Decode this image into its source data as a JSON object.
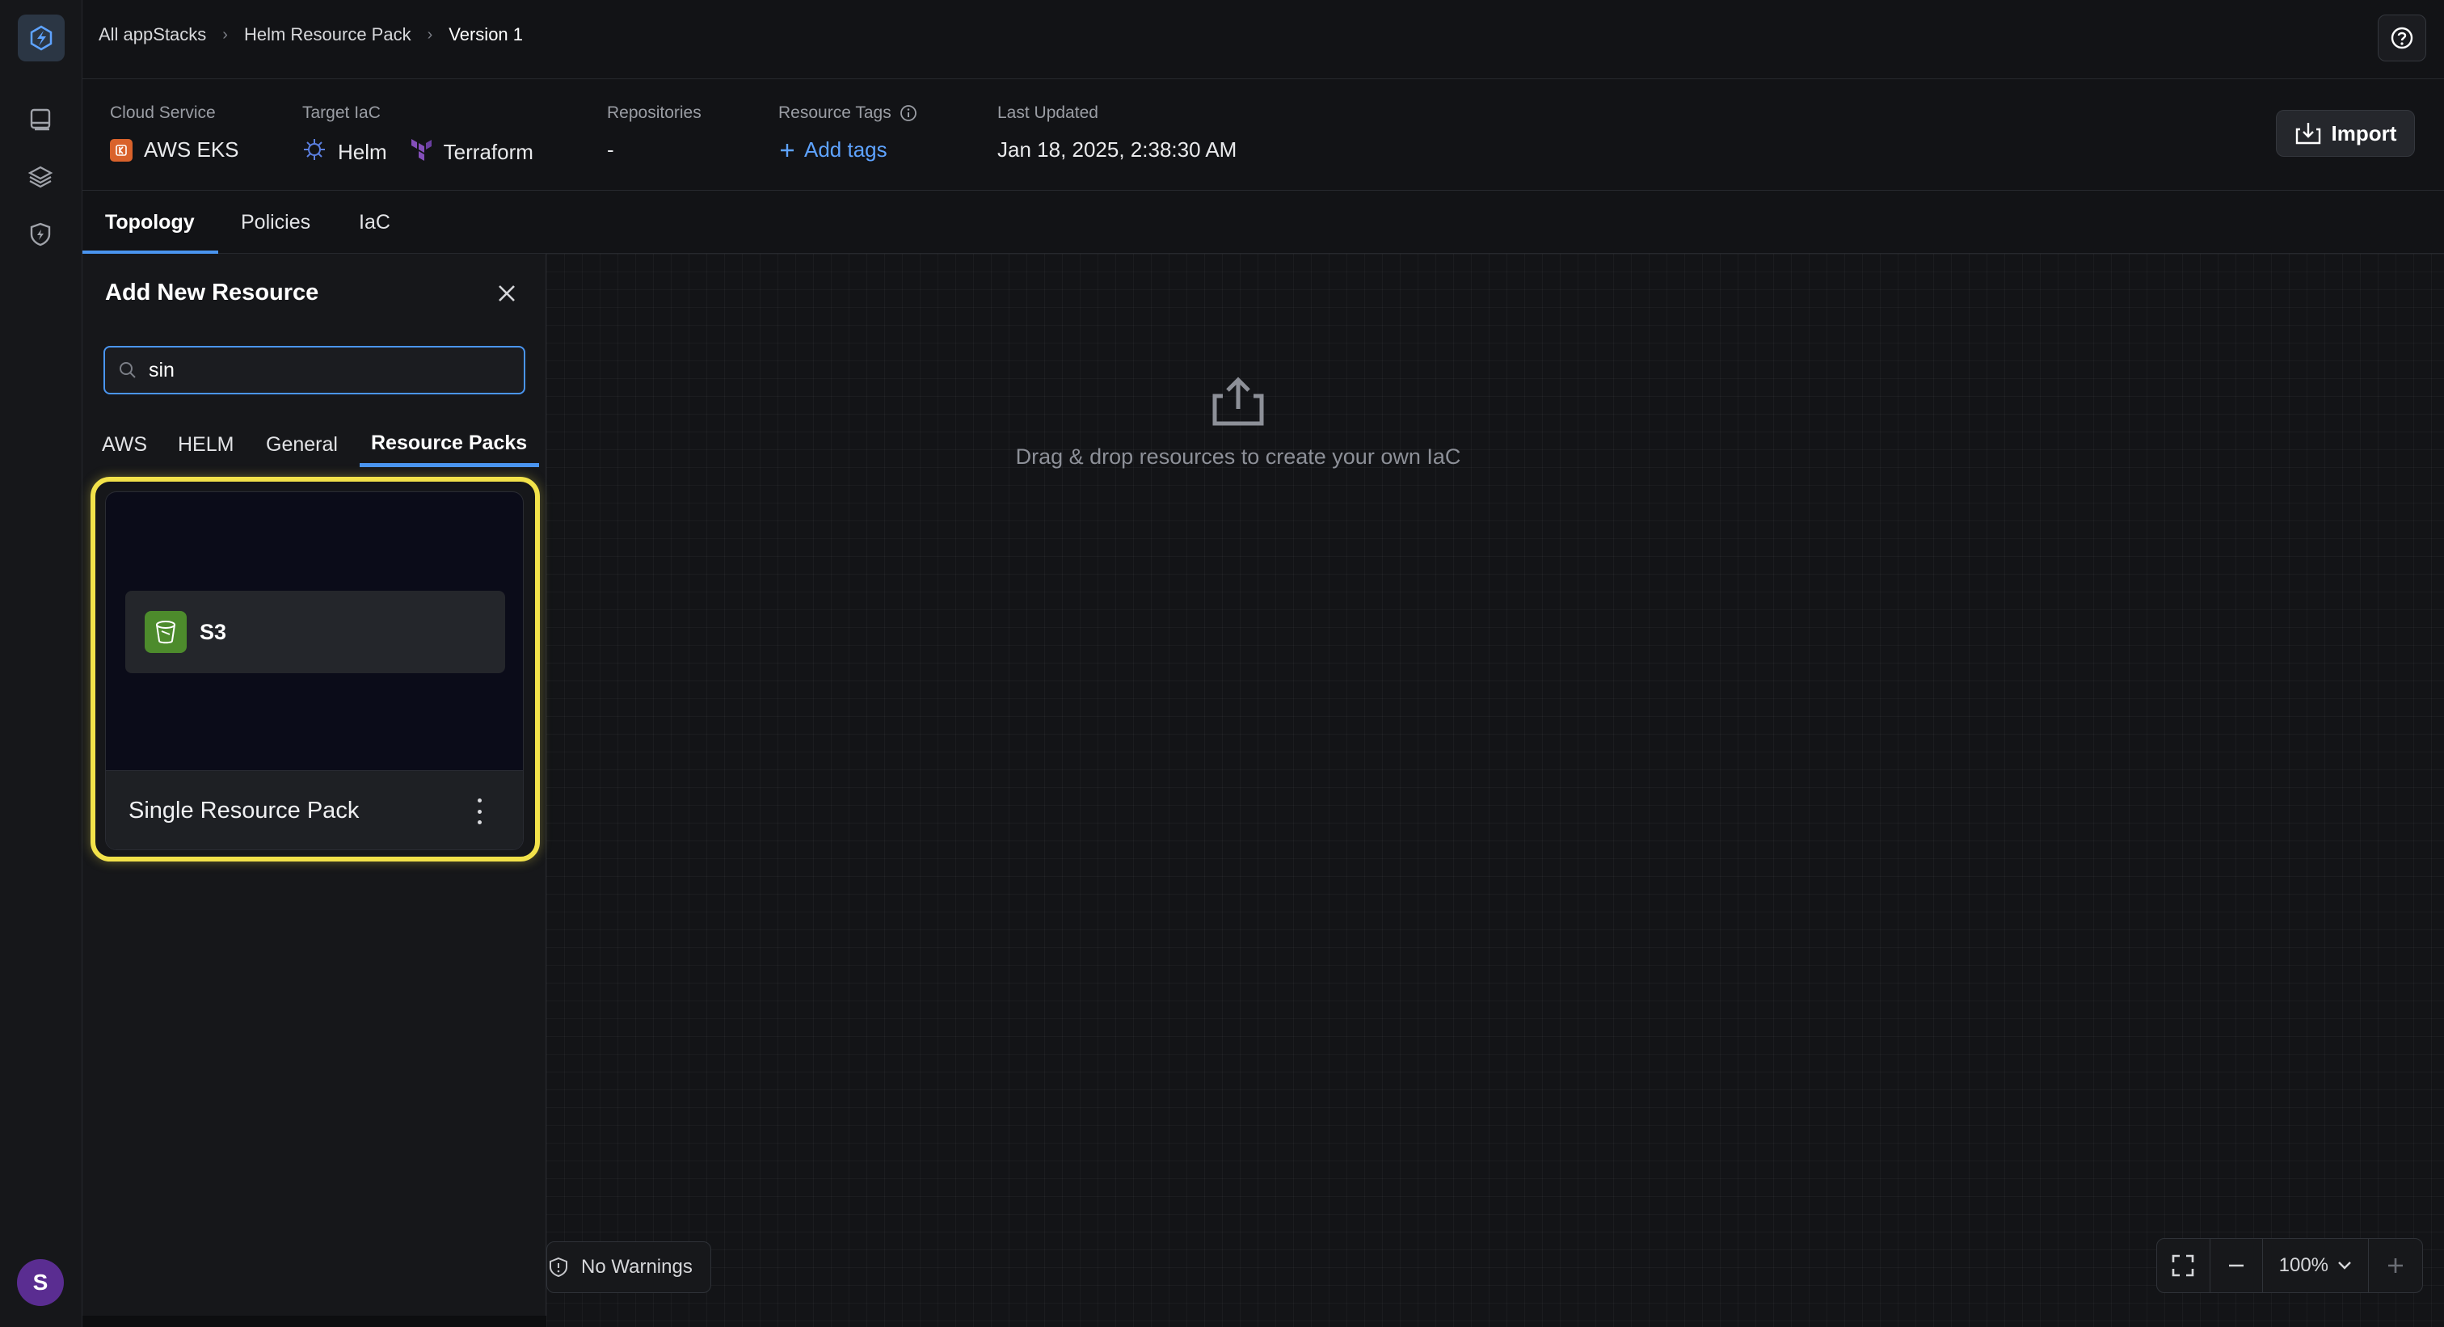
{
  "breadcrumb": {
    "items": [
      "All appStacks",
      "Helm Resource Pack",
      "Version 1"
    ]
  },
  "info": {
    "cloud_service": {
      "label": "Cloud Service",
      "value": "AWS EKS",
      "icon": "aws-eks-icon"
    },
    "target_iac": {
      "label": "Target IaC",
      "values": [
        "Helm",
        "Terraform"
      ]
    },
    "repositories": {
      "label": "Repositories",
      "value": "-"
    },
    "resource_tags": {
      "label": "Resource Tags",
      "action": "Add tags"
    },
    "last_updated": {
      "label": "Last Updated",
      "value": "Jan 18, 2025, 2:38:30 AM"
    }
  },
  "toolbar": {
    "import_label": "Import"
  },
  "tabs": [
    {
      "label": "Topology",
      "active": true
    },
    {
      "label": "Policies",
      "active": false
    },
    {
      "label": "IaC",
      "active": false
    }
  ],
  "panel": {
    "title": "Add New Resource",
    "search": {
      "value": "sin",
      "placeholder": ""
    },
    "categories": [
      {
        "label": "AWS",
        "active": false
      },
      {
        "label": "HELM",
        "active": false
      },
      {
        "label": "General",
        "active": false
      },
      {
        "label": "Resource Packs",
        "active": true
      }
    ],
    "pack": {
      "resource_label": "S3",
      "name": "Single Resource Pack"
    }
  },
  "canvas": {
    "hint": "Drag & drop resources to create your own IaC",
    "warnings": "No Warnings",
    "zoom": "100%"
  },
  "user": {
    "initial": "S"
  },
  "colors": {
    "accent": "#4a95f0",
    "highlight": "#f2e24a",
    "avatar": "#5a2d91",
    "s3": "#4d8b2c"
  }
}
